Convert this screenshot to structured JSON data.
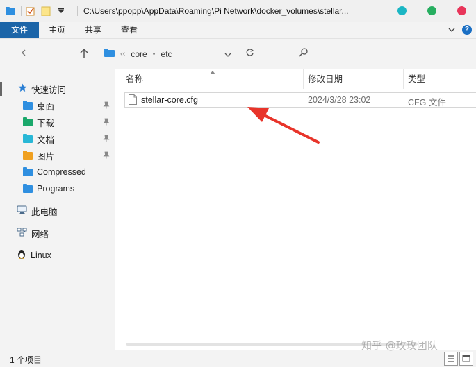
{
  "window": {
    "title": "C:\\Users\\ppopp\\AppData\\Roaming\\Pi Network\\docker_volumes\\stellar...",
    "control_colors": [
      "#1bb6c4",
      "#27ae60",
      "#e8355a"
    ]
  },
  "ribbon": {
    "tabs": [
      "文件",
      "主页",
      "共享",
      "查看"
    ],
    "accent": "#1c65a8"
  },
  "nav": {
    "breadcrumbs": [
      "core",
      "etc"
    ],
    "crumb_prefix": "‹‹"
  },
  "sidebar": {
    "quick_access": "快速访问",
    "items": [
      {
        "label": "桌面",
        "color": "#2f8fe0",
        "pinned": true
      },
      {
        "label": "下载",
        "color": "#1aa86b",
        "pinned": true
      },
      {
        "label": "文档",
        "color": "#28b7d6",
        "pinned": true
      },
      {
        "label": "图片",
        "color": "#f0a020",
        "pinned": true
      },
      {
        "label": "Compressed",
        "color": "#2f8fe0",
        "pinned": false
      },
      {
        "label": "Programs",
        "color": "#2f8fe0",
        "pinned": false
      }
    ],
    "this_pc": "此电脑",
    "network": "网络",
    "linux": "Linux"
  },
  "columns": {
    "name": "名称",
    "modified": "修改日期",
    "type": "类型"
  },
  "files": [
    {
      "name": "stellar-core.cfg",
      "modified": "2024/3/28 23:02",
      "type": "CFG 文件"
    }
  ],
  "status": {
    "item_count": "1 个项目"
  },
  "watermark": "知乎 @玫玫团队",
  "annotation_color": "#e8342a"
}
